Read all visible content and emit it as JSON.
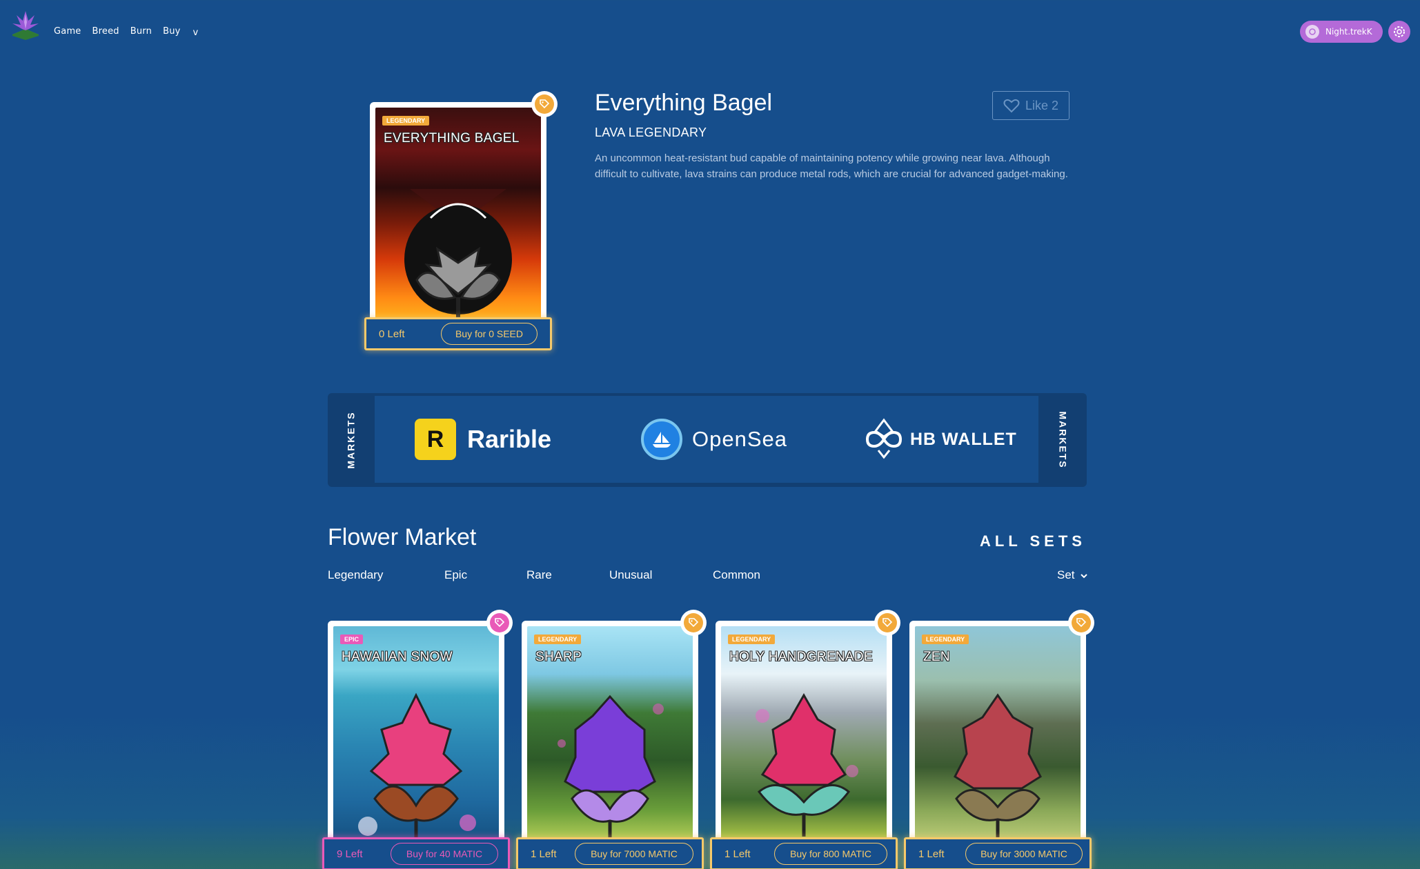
{
  "nav": {
    "links": [
      "Game",
      "Breed",
      "Burn",
      "Buy"
    ],
    "caret": "v",
    "user": "Night.trekK",
    "icons": {
      "logo": "leaf-logo-icon",
      "settings": "gear-icon"
    }
  },
  "featured": {
    "rarity": "LEGENDARY",
    "card_name": "EVERYTHING BAGEL",
    "title": "Everything Bagel",
    "subtitle": "LAVA LEGENDARY",
    "description": "An uncommon heat-resistant bud capable of maintaining potency while growing near lava. Although difficult to cultivate, lava strains can produce metal rods, which are crucial for advanced gadget-making.",
    "left": "0 Left",
    "buy_label": "Buy for 0 SEED",
    "like_label": "Like 2",
    "accent": "#f6c96a"
  },
  "markets": {
    "side_label": "MARKETS",
    "items": [
      {
        "name": "Rarible",
        "logo": "R",
        "icon": "rarible-logo-icon"
      },
      {
        "name": "OpenSea",
        "icon": "opensea-logo-icon"
      },
      {
        "name": "HB WALLET",
        "icon": "hb-wallet-logo-icon"
      }
    ]
  },
  "flower_market": {
    "title": "Flower Market",
    "all_sets": "ALL SETS",
    "filters": [
      "Legendary",
      "Epic",
      "Rare",
      "Unusual",
      "Common"
    ],
    "set_label": "Set",
    "cards": [
      {
        "rarity": "EPIC",
        "name": "HAWAIIAN SNOW",
        "left": "9 Left",
        "buy_label": "Buy for 40 MATIC",
        "color": "#e95ab8"
      },
      {
        "rarity": "LEGENDARY",
        "name": "SHARP",
        "left": "1 Left",
        "buy_label": "Buy for 7000 MATIC",
        "color": "#f6c96a"
      },
      {
        "rarity": "LEGENDARY",
        "name": "HOLY HANDGRENADE",
        "left": "1 Left",
        "buy_label": "Buy for 800 MATIC",
        "color": "#f6c96a"
      },
      {
        "rarity": "LEGENDARY",
        "name": "ZEN",
        "left": "1 Left",
        "buy_label": "Buy for 3000 MATIC",
        "color": "#f6c96a"
      }
    ]
  },
  "colors": {
    "background": "#164e8c",
    "panel": "#123f72",
    "user_pill": "#b46ad8",
    "legendary": "#f2a93a",
    "epic": "#e95ab8"
  }
}
